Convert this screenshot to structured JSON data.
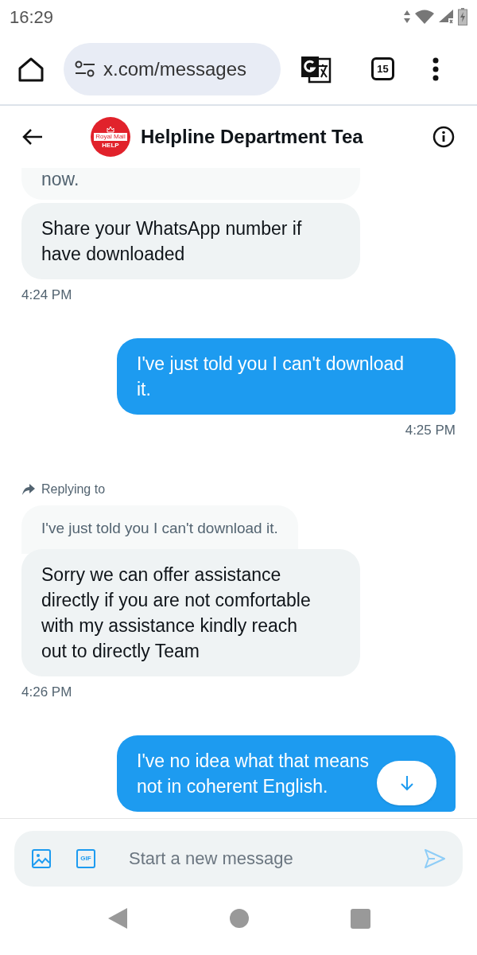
{
  "status_bar": {
    "time": "16:29"
  },
  "browser": {
    "url": "x.com/messages",
    "tab_count": "15"
  },
  "header": {
    "avatar": {
      "logo_text": "Royal Mail",
      "badge_text": "HELP"
    },
    "title": "Helpline Department Tea"
  },
  "messages": [
    {
      "kind": "received",
      "text": "now.",
      "clipped_top": true
    },
    {
      "kind": "received",
      "text": "Share your WhatsApp number if have downloaded"
    },
    {
      "kind": "time",
      "text": "4:24 PM"
    },
    {
      "kind": "sent",
      "text": "I've just told you I can't download it."
    },
    {
      "kind": "time",
      "text": "4:25 PM"
    },
    {
      "kind": "reply",
      "text": "Replying to"
    },
    {
      "kind": "quote",
      "text": "I've just told you I can't download it."
    },
    {
      "kind": "received",
      "text": "Sorry we can offer assistance directly if you are not comfortable with my assistance kindly reach out to directly Team"
    },
    {
      "kind": "time",
      "text": "4:26 PM"
    },
    {
      "kind": "sent",
      "text": "I've no idea what that means not in coherent English.",
      "last": true
    }
  ],
  "composer": {
    "placeholder": "Start a new message",
    "gif_label": "GIF"
  }
}
